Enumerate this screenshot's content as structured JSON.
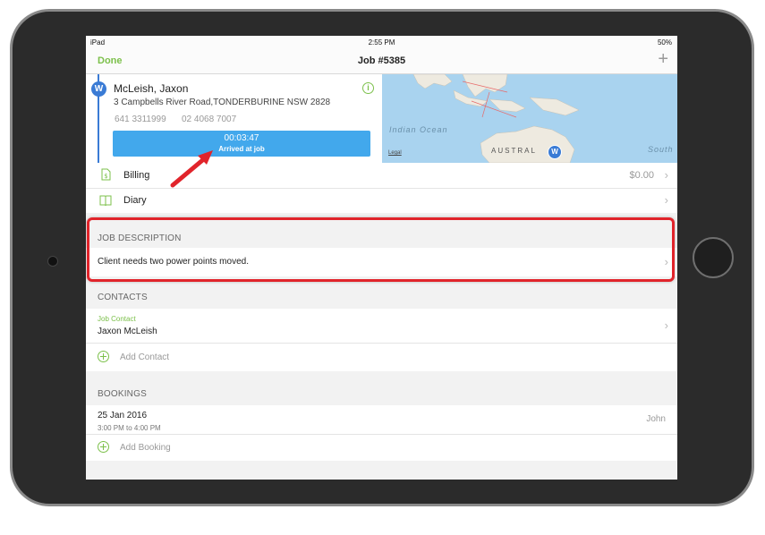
{
  "statusbar": {
    "device": "iPad",
    "time": "2:55 PM",
    "battery": "50%"
  },
  "navbar": {
    "done_label": "Done",
    "title": "Job #5385",
    "add_label": "+"
  },
  "job": {
    "badge": "W",
    "client_name": "McLeish, Jaxon",
    "address": "3 Campbells River Road,TONDERBURINE NSW 2828",
    "phone_mobile": "641 3311999",
    "phone_landline": "02 4068 7007",
    "info_icon": "info-icon",
    "timer": "00:03:47",
    "timer_status": "Arrived at job"
  },
  "map": {
    "ocean_label": "Indian Ocean",
    "south_label": "South",
    "country_label": "AUSTRAL",
    "legal_label": "Legal",
    "pin_label": "W"
  },
  "rows": {
    "billing_label": "Billing",
    "billing_value": "$0.00",
    "diary_label": "Diary"
  },
  "job_description": {
    "header": "JOB DESCRIPTION",
    "text": "Client needs two power points moved."
  },
  "contacts": {
    "header": "CONTACTS",
    "role": "Job Contact",
    "name": "Jaxon McLeish",
    "add_label": "Add Contact"
  },
  "bookings": {
    "header": "BOOKINGS",
    "date": "25 Jan 2016",
    "time_range": "3:00 PM to 4:00 PM",
    "assignee": "John",
    "add_label": "Add Booking"
  },
  "colors": {
    "accent_green": "#7cc04b",
    "timer_blue": "#42a8ec",
    "badge_blue": "#3a7bd5",
    "highlight_red": "#e1242b",
    "map_water": "#a9d3ef"
  }
}
